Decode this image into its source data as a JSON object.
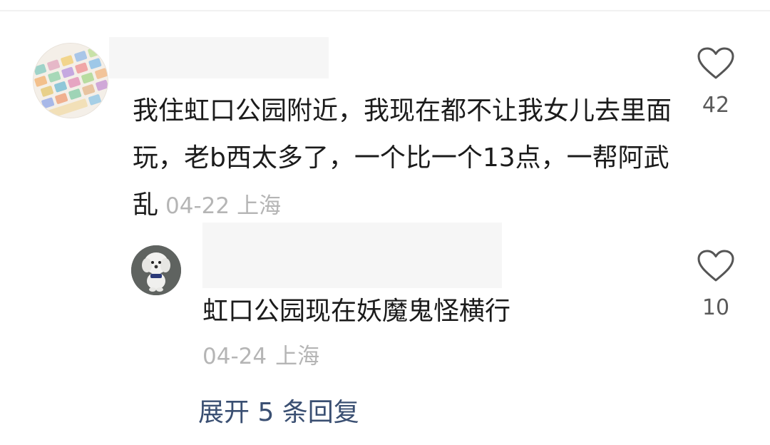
{
  "comment": {
    "text": "我住虹口公园附近，我现在都不让我女儿去里面玩，老b西太多了，一个比一个13点，一帮阿武乱",
    "date": "04-22",
    "location": "上海",
    "like_count": "42",
    "avatar_icon": "keyboard-avatar-icon",
    "like_icon": "heart-outline-icon"
  },
  "reply": {
    "text": "虹口公园现在妖魔鬼怪横行",
    "date": "04-24",
    "location": "上海",
    "like_count": "10",
    "avatar_icon": "dog-avatar-icon",
    "like_icon": "heart-outline-icon"
  },
  "expand_replies": "展开 5 条回复",
  "colors": {
    "text": "#1b1b1b",
    "meta": "#b5b5b5",
    "count": "#5a5a5a",
    "link": "#3a4f72"
  }
}
